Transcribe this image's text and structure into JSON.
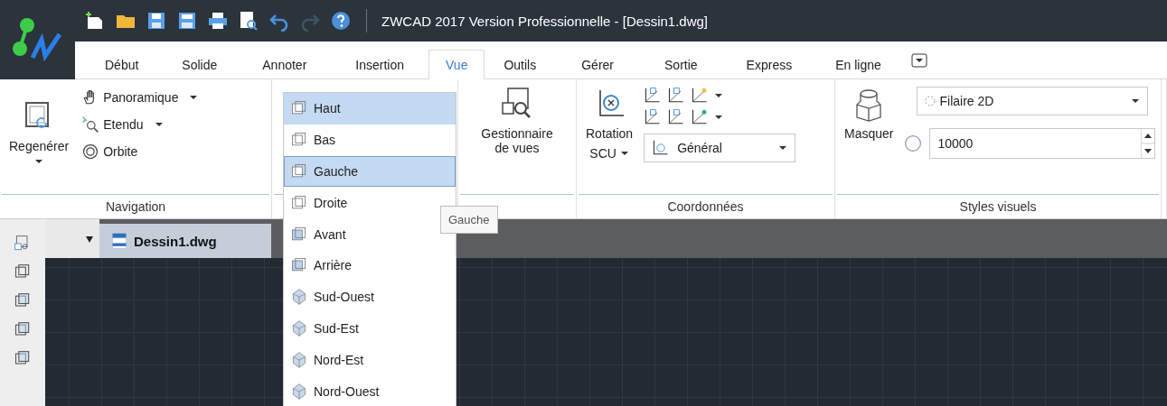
{
  "window": {
    "title": "ZWCAD 2017 Version Professionnelle - [Dessin1.dwg]"
  },
  "tabs": [
    {
      "label": "Début",
      "selected": false
    },
    {
      "label": "Solide",
      "selected": false
    },
    {
      "label": "Annoter",
      "selected": false
    },
    {
      "label": "Insertion",
      "selected": false
    },
    {
      "label": "Vue",
      "selected": true
    },
    {
      "label": "Outils",
      "selected": false
    },
    {
      "label": "Gérer",
      "selected": false
    },
    {
      "label": "Sortie",
      "selected": false
    },
    {
      "label": "Express",
      "selected": false
    },
    {
      "label": "En ligne",
      "selected": false
    }
  ],
  "navigation": {
    "label": "Navigation",
    "regen": "Regenérer",
    "items": [
      {
        "label": "Panoramique",
        "dropdown": true
      },
      {
        "label": "Etendu",
        "dropdown": true
      },
      {
        "label": "Orbite",
        "dropdown": false
      }
    ]
  },
  "view_manager": {
    "label": "Gestionnaire de vues"
  },
  "coordinates": {
    "label": "Coordonnées",
    "rotation": "Rotation",
    "ucs": "SCU",
    "ucs_dropdown": "Général"
  },
  "visual_styles": {
    "label": "Styles visuels",
    "style": "Filaire 2D",
    "hide": "Masquer",
    "value": "10000"
  },
  "document_tab": {
    "title": "Dessin1.dwg"
  },
  "view_menu": {
    "items": [
      {
        "label": "Haut",
        "highlighted": true,
        "focused": false
      },
      {
        "label": "Bas",
        "highlighted": false,
        "focused": false
      },
      {
        "label": "Gauche",
        "highlighted": true,
        "focused": true
      },
      {
        "label": "Droite",
        "highlighted": false,
        "focused": false
      },
      {
        "label": "Avant",
        "highlighted": false,
        "focused": false
      },
      {
        "label": "Arrière",
        "highlighted": false,
        "focused": false
      },
      {
        "label": "Sud-Ouest",
        "highlighted": false,
        "focused": false
      },
      {
        "label": "Sud-Est",
        "highlighted": false,
        "focused": false
      },
      {
        "label": "Nord-Est",
        "highlighted": false,
        "focused": false
      },
      {
        "label": "Nord-Ouest",
        "highlighted": false,
        "focused": false
      }
    ]
  },
  "tooltip": {
    "text": "Gauche"
  }
}
